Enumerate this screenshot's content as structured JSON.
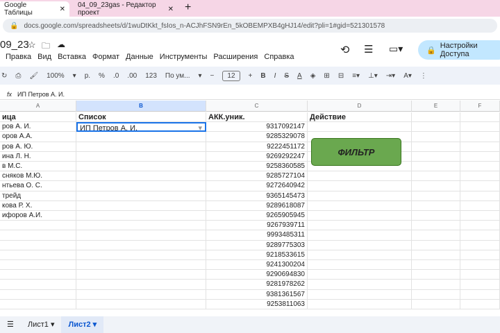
{
  "browser": {
    "tabs": [
      {
        "label": "Google Таблицы"
      },
      {
        "label": "04_09_23gas - Редактор проект"
      }
    ],
    "new_tab": "+",
    "url": "docs.google.com/spreadsheets/d/1wuDtKkt_fsIos_n-ACJhFSN9rEn_5kOBEMPXB4gHJ14/edit?pli=1#gid=521301578"
  },
  "doc": {
    "title": "09_23",
    "share_label": "Настройки Доступа"
  },
  "menu": [
    "Правка",
    "Вид",
    "Вставка",
    "Формат",
    "Данные",
    "Инструменты",
    "Расширения",
    "Справка"
  ],
  "toolbar": {
    "zoom": "100%",
    "currency": "р.",
    "percent": "%",
    "dec_less": ".0",
    "dec_more": ".00",
    "format_123": "123",
    "font": "По ум...",
    "font_size": "12",
    "bold": "B",
    "italic": "I",
    "strike": "S",
    "text_color": "A"
  },
  "formula": {
    "fx": "fx",
    "value": "ИП Петров А. И."
  },
  "columns": [
    "A",
    "B",
    "C",
    "D",
    "E",
    "F"
  ],
  "headers": {
    "a": "ица",
    "b": "Список",
    "c": "АКК.уник.",
    "d": "Действие"
  },
  "col_a": [
    "ров А. И.",
    "оров А.А.",
    "ров А. Ю.",
    "ина Л. Н.",
    "в М.С.",
    "сняков М.Ю.",
    "нтьева О. С.",
    "трейд",
    "кова Р. Х.",
    "ифоров А.И."
  ],
  "col_b_selected": "ИП Петров А. И.",
  "col_c": [
    "9317092147",
    "9285329078",
    "9222451172",
    "9269292247",
    "9258360585",
    "9285727104",
    "9272640942",
    "9365145473",
    "9289618087",
    "9265905945",
    "9267939711",
    "9993485311",
    "9289775303",
    "9218533615",
    "9241300204",
    "9290694830",
    "9281978262",
    "9381361567",
    "9253811063"
  ],
  "filter_button": "ФИЛЬТР",
  "sheets": [
    {
      "label": "Лист1"
    },
    {
      "label": "Лист2"
    }
  ],
  "colors": {
    "accent": "#1a73e8",
    "button": "#6aa84f"
  }
}
